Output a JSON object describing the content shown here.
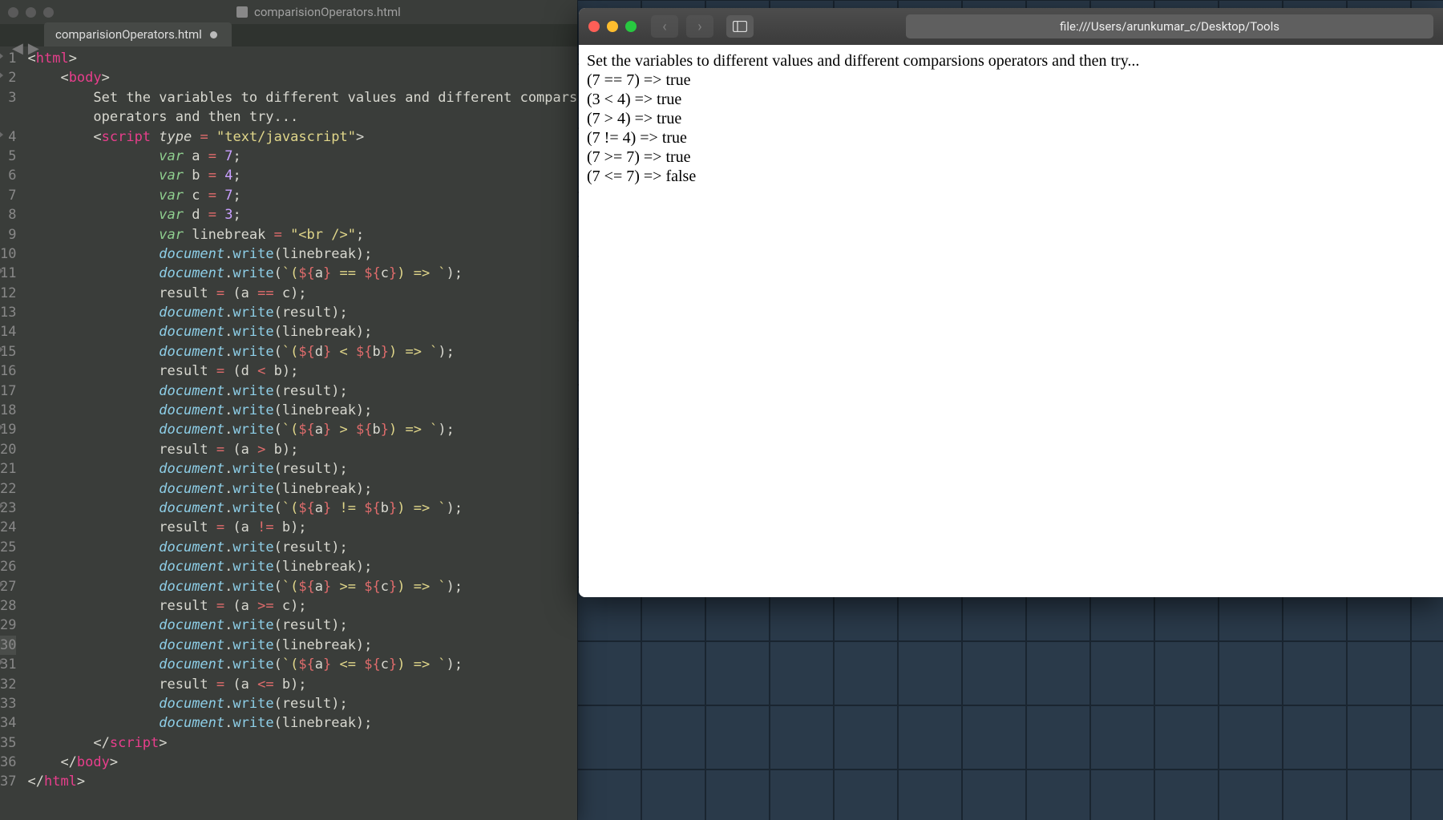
{
  "editor": {
    "window_title": "comparisionOperators.html",
    "tab_name": "comparisionOperators.html",
    "lines": [
      "1",
      "2",
      "3",
      "",
      "4",
      "5",
      "6",
      "7",
      "8",
      "9",
      "10",
      "11",
      "12",
      "13",
      "14",
      "15",
      "16",
      "17",
      "18",
      "19",
      "20",
      "21",
      "22",
      "23",
      "24",
      "25",
      "26",
      "27",
      "28",
      "29",
      "30",
      "31",
      "32",
      "33",
      "34",
      "35",
      "36",
      "37"
    ],
    "fold_lines": [
      1,
      2,
      4,
      11,
      15,
      19,
      23,
      27,
      31
    ],
    "current_line_index": 30
  },
  "code_tokens": {
    "l1": [
      [
        "<",
        "t-punc"
      ],
      [
        "html",
        "t-tag"
      ],
      [
        ">",
        "t-punc"
      ]
    ],
    "l2": [
      [
        "    ",
        ""
      ],
      [
        "<",
        "t-punc"
      ],
      [
        "body",
        "t-tag"
      ],
      [
        ">",
        "t-punc"
      ]
    ],
    "l3a": [
      [
        "        ",
        ""
      ],
      [
        "Set the variables to different values and different comparsions",
        "t-text"
      ]
    ],
    "l3b": [
      [
        "        ",
        ""
      ],
      [
        "operators and then try...",
        "t-text"
      ]
    ],
    "l4": [
      [
        "        ",
        ""
      ],
      [
        "<",
        "t-punc"
      ],
      [
        "script",
        "t-tag"
      ],
      [
        " ",
        "t-punc"
      ],
      [
        "type",
        "t-attr"
      ],
      [
        " ",
        "t-punc"
      ],
      [
        "=",
        "t-op"
      ],
      [
        " ",
        "t-punc"
      ],
      [
        "\"text/javascript\"",
        "t-str"
      ],
      [
        ">",
        "t-punc"
      ]
    ],
    "l5": [
      [
        "                ",
        ""
      ],
      [
        "var",
        "t-var"
      ],
      [
        " a ",
        "t-text"
      ],
      [
        "=",
        "t-op"
      ],
      [
        " ",
        "t-text"
      ],
      [
        "7",
        "t-num"
      ],
      [
        ";",
        "t-punc"
      ]
    ],
    "l6": [
      [
        "                ",
        ""
      ],
      [
        "var",
        "t-var"
      ],
      [
        " b ",
        "t-text"
      ],
      [
        "=",
        "t-op"
      ],
      [
        " ",
        "t-text"
      ],
      [
        "4",
        "t-num"
      ],
      [
        ";",
        "t-punc"
      ]
    ],
    "l7": [
      [
        "                ",
        ""
      ],
      [
        "var",
        "t-var"
      ],
      [
        " c ",
        "t-text"
      ],
      [
        "=",
        "t-op"
      ],
      [
        " ",
        "t-text"
      ],
      [
        "7",
        "t-num"
      ],
      [
        ";",
        "t-punc"
      ]
    ],
    "l8": [
      [
        "                ",
        ""
      ],
      [
        "var",
        "t-var"
      ],
      [
        " d ",
        "t-text"
      ],
      [
        "=",
        "t-op"
      ],
      [
        " ",
        "t-text"
      ],
      [
        "3",
        "t-num"
      ],
      [
        ";",
        "t-punc"
      ]
    ],
    "l9": [
      [
        "                ",
        ""
      ],
      [
        "var",
        "t-var"
      ],
      [
        " linebreak ",
        "t-text"
      ],
      [
        "=",
        "t-op"
      ],
      [
        " ",
        "t-text"
      ],
      [
        "\"<br />\"",
        "t-str"
      ],
      [
        ";",
        "t-punc"
      ]
    ],
    "l10": [
      [
        "                ",
        ""
      ],
      [
        "document",
        "t-id"
      ],
      [
        ".",
        "t-punc"
      ],
      [
        "write",
        "t-func"
      ],
      [
        "(linebreak);",
        "t-punc"
      ]
    ],
    "l11": [
      [
        "                ",
        ""
      ],
      [
        "document",
        "t-id"
      ],
      [
        ".",
        "t-punc"
      ],
      [
        "write",
        "t-func"
      ],
      [
        "(",
        "t-punc"
      ],
      [
        "`(",
        "t-backtick"
      ],
      [
        "${",
        "t-op"
      ],
      [
        "a",
        "t-text"
      ],
      [
        "}",
        "t-op"
      ],
      [
        " == ",
        "t-backtick"
      ],
      [
        "${",
        "t-op"
      ],
      [
        "c",
        "t-text"
      ],
      [
        "}",
        "t-op"
      ],
      [
        ") => `",
        "t-backtick"
      ],
      [
        ");",
        "t-punc"
      ]
    ],
    "l12": [
      [
        "                ",
        ""
      ],
      [
        "result ",
        "t-text"
      ],
      [
        "=",
        "t-op"
      ],
      [
        " (a ",
        "t-text"
      ],
      [
        "==",
        "t-op"
      ],
      [
        " c);",
        "t-text"
      ]
    ],
    "l13": [
      [
        "                ",
        ""
      ],
      [
        "document",
        "t-id"
      ],
      [
        ".",
        "t-punc"
      ],
      [
        "write",
        "t-func"
      ],
      [
        "(result);",
        "t-punc"
      ]
    ],
    "l14": [
      [
        "                ",
        ""
      ],
      [
        "document",
        "t-id"
      ],
      [
        ".",
        "t-punc"
      ],
      [
        "write",
        "t-func"
      ],
      [
        "(linebreak);",
        "t-punc"
      ]
    ],
    "l15": [
      [
        "                ",
        ""
      ],
      [
        "document",
        "t-id"
      ],
      [
        ".",
        "t-punc"
      ],
      [
        "write",
        "t-func"
      ],
      [
        "(",
        "t-punc"
      ],
      [
        "`(",
        "t-backtick"
      ],
      [
        "${",
        "t-op"
      ],
      [
        "d",
        "t-text"
      ],
      [
        "}",
        "t-op"
      ],
      [
        " < ",
        "t-backtick"
      ],
      [
        "${",
        "t-op"
      ],
      [
        "b",
        "t-text"
      ],
      [
        "}",
        "t-op"
      ],
      [
        ") => `",
        "t-backtick"
      ],
      [
        ");",
        "t-punc"
      ]
    ],
    "l16": [
      [
        "                ",
        ""
      ],
      [
        "result ",
        "t-text"
      ],
      [
        "=",
        "t-op"
      ],
      [
        " (d ",
        "t-text"
      ],
      [
        "<",
        "t-op"
      ],
      [
        " b);",
        "t-text"
      ]
    ],
    "l17": [
      [
        "                ",
        ""
      ],
      [
        "document",
        "t-id"
      ],
      [
        ".",
        "t-punc"
      ],
      [
        "write",
        "t-func"
      ],
      [
        "(result);",
        "t-punc"
      ]
    ],
    "l18": [
      [
        "                ",
        ""
      ],
      [
        "document",
        "t-id"
      ],
      [
        ".",
        "t-punc"
      ],
      [
        "write",
        "t-func"
      ],
      [
        "(linebreak);",
        "t-punc"
      ]
    ],
    "l19": [
      [
        "                ",
        ""
      ],
      [
        "document",
        "t-id"
      ],
      [
        ".",
        "t-punc"
      ],
      [
        "write",
        "t-func"
      ],
      [
        "(",
        "t-punc"
      ],
      [
        "`(",
        "t-backtick"
      ],
      [
        "${",
        "t-op"
      ],
      [
        "a",
        "t-text"
      ],
      [
        "}",
        "t-op"
      ],
      [
        " > ",
        "t-backtick"
      ],
      [
        "${",
        "t-op"
      ],
      [
        "b",
        "t-text"
      ],
      [
        "}",
        "t-op"
      ],
      [
        ") => `",
        "t-backtick"
      ],
      [
        ");",
        "t-punc"
      ]
    ],
    "l20": [
      [
        "                ",
        ""
      ],
      [
        "result ",
        "t-text"
      ],
      [
        "=",
        "t-op"
      ],
      [
        " (a ",
        "t-text"
      ],
      [
        ">",
        "t-op"
      ],
      [
        " b);",
        "t-text"
      ]
    ],
    "l21": [
      [
        "                ",
        ""
      ],
      [
        "document",
        "t-id"
      ],
      [
        ".",
        "t-punc"
      ],
      [
        "write",
        "t-func"
      ],
      [
        "(result);",
        "t-punc"
      ]
    ],
    "l22": [
      [
        "                ",
        ""
      ],
      [
        "document",
        "t-id"
      ],
      [
        ".",
        "t-punc"
      ],
      [
        "write",
        "t-func"
      ],
      [
        "(linebreak);",
        "t-punc"
      ]
    ],
    "l23": [
      [
        "                ",
        ""
      ],
      [
        "document",
        "t-id"
      ],
      [
        ".",
        "t-punc"
      ],
      [
        "write",
        "t-func"
      ],
      [
        "(",
        "t-punc"
      ],
      [
        "`(",
        "t-backtick"
      ],
      [
        "${",
        "t-op"
      ],
      [
        "a",
        "t-text"
      ],
      [
        "}",
        "t-op"
      ],
      [
        " != ",
        "t-backtick"
      ],
      [
        "${",
        "t-op"
      ],
      [
        "b",
        "t-text"
      ],
      [
        "}",
        "t-op"
      ],
      [
        ") => `",
        "t-backtick"
      ],
      [
        ");",
        "t-punc"
      ]
    ],
    "l24": [
      [
        "                ",
        ""
      ],
      [
        "result ",
        "t-text"
      ],
      [
        "=",
        "t-op"
      ],
      [
        " (a ",
        "t-text"
      ],
      [
        "!=",
        "t-op"
      ],
      [
        " b);",
        "t-text"
      ]
    ],
    "l25": [
      [
        "                ",
        ""
      ],
      [
        "document",
        "t-id"
      ],
      [
        ".",
        "t-punc"
      ],
      [
        "write",
        "t-func"
      ],
      [
        "(result);",
        "t-punc"
      ]
    ],
    "l26": [
      [
        "                ",
        ""
      ],
      [
        "document",
        "t-id"
      ],
      [
        ".",
        "t-punc"
      ],
      [
        "write",
        "t-func"
      ],
      [
        "(linebreak);",
        "t-punc"
      ]
    ],
    "l27": [
      [
        "                ",
        ""
      ],
      [
        "document",
        "t-id"
      ],
      [
        ".",
        "t-punc"
      ],
      [
        "write",
        "t-func"
      ],
      [
        "(",
        "t-punc"
      ],
      [
        "`(",
        "t-backtick"
      ],
      [
        "${",
        "t-op"
      ],
      [
        "a",
        "t-text"
      ],
      [
        "}",
        "t-op"
      ],
      [
        " >= ",
        "t-backtick"
      ],
      [
        "${",
        "t-op"
      ],
      [
        "c",
        "t-text"
      ],
      [
        "}",
        "t-op"
      ],
      [
        ") => `",
        "t-backtick"
      ],
      [
        ");",
        "t-punc"
      ]
    ],
    "l28": [
      [
        "                ",
        ""
      ],
      [
        "result ",
        "t-text"
      ],
      [
        "=",
        "t-op"
      ],
      [
        " (a ",
        "t-text"
      ],
      [
        ">=",
        "t-op"
      ],
      [
        " c);",
        "t-text"
      ]
    ],
    "l29": [
      [
        "                ",
        ""
      ],
      [
        "document",
        "t-id"
      ],
      [
        ".",
        "t-punc"
      ],
      [
        "write",
        "t-func"
      ],
      [
        "(result);",
        "t-punc"
      ]
    ],
    "l30": [
      [
        "                ",
        ""
      ],
      [
        "document",
        "t-id"
      ],
      [
        ".",
        "t-punc"
      ],
      [
        "write",
        "t-func"
      ],
      [
        "(linebreak);",
        "t-punc"
      ]
    ],
    "l31": [
      [
        "                ",
        ""
      ],
      [
        "document",
        "t-id"
      ],
      [
        ".",
        "t-punc"
      ],
      [
        "write",
        "t-func"
      ],
      [
        "(",
        "t-punc"
      ],
      [
        "`(",
        "t-backtick"
      ],
      [
        "${",
        "t-op"
      ],
      [
        "a",
        "t-text"
      ],
      [
        "}",
        "t-op"
      ],
      [
        " <= ",
        "t-backtick"
      ],
      [
        "${",
        "t-op"
      ],
      [
        "c",
        "t-text"
      ],
      [
        "}",
        "t-op"
      ],
      [
        ") => `",
        "t-backtick"
      ],
      [
        ");",
        "t-punc"
      ]
    ],
    "l32": [
      [
        "                ",
        ""
      ],
      [
        "result ",
        "t-text"
      ],
      [
        "=",
        "t-op"
      ],
      [
        " (a ",
        "t-text"
      ],
      [
        "<=",
        "t-op"
      ],
      [
        " b);",
        "t-text"
      ]
    ],
    "l33": [
      [
        "                ",
        ""
      ],
      [
        "document",
        "t-id"
      ],
      [
        ".",
        "t-punc"
      ],
      [
        "write",
        "t-func"
      ],
      [
        "(result);",
        "t-punc"
      ]
    ],
    "l34": [
      [
        "                ",
        ""
      ],
      [
        "document",
        "t-id"
      ],
      [
        ".",
        "t-punc"
      ],
      [
        "write",
        "t-func"
      ],
      [
        "(linebreak);",
        "t-punc"
      ]
    ],
    "l35": [
      [
        "        ",
        ""
      ],
      [
        "</",
        "t-punc"
      ],
      [
        "script",
        "t-tag"
      ],
      [
        ">",
        "t-punc"
      ]
    ],
    "l36": [
      [
        "    ",
        ""
      ],
      [
        "</",
        "t-punc"
      ],
      [
        "body",
        "t-tag"
      ],
      [
        ">",
        "t-punc"
      ]
    ],
    "l37": [
      [
        "</",
        "t-punc"
      ],
      [
        "html",
        "t-tag"
      ],
      [
        ">",
        "t-punc"
      ]
    ]
  },
  "browser": {
    "url": "file:///Users/arunkumar_c/Desktop/Tools",
    "output": [
      "Set the variables to different values and different comparsions operators and then try...",
      "(7 == 7) => true",
      "(3 < 4) => true",
      "(7 > 4) => true",
      "(7 != 4) => true",
      "(7 >= 7) => true",
      "(7 <= 7) => false"
    ]
  }
}
